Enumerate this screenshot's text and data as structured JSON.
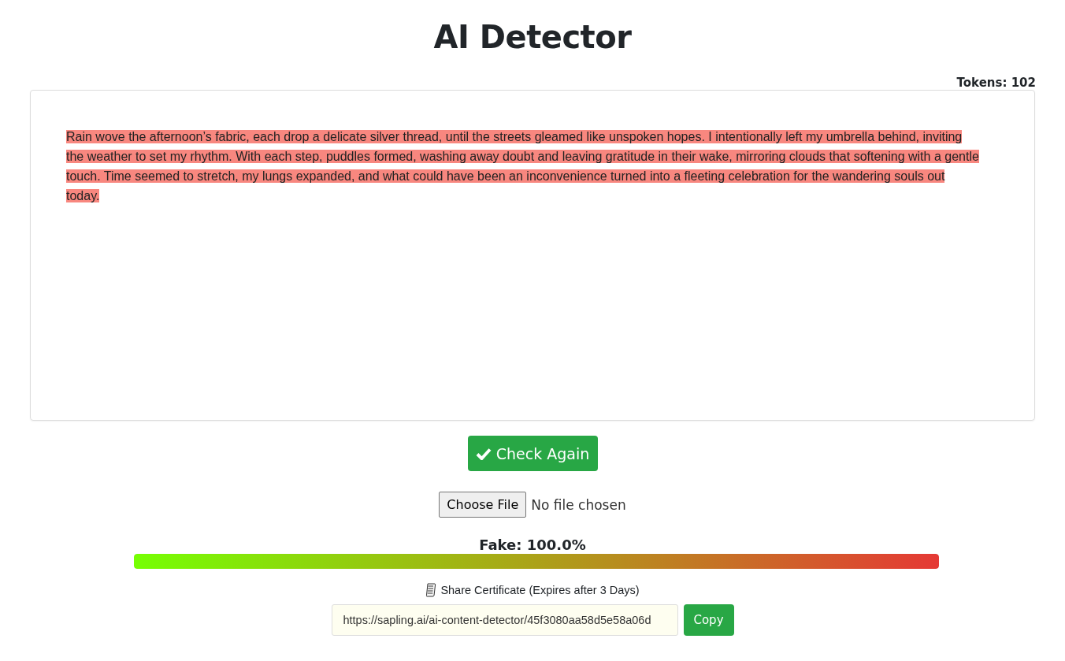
{
  "title": "AI Detector",
  "tokens": "Tokens: 102",
  "passage": {
    "text": "Rain wove the afternoon’s fabric, each drop a delicate silver thread, until the streets gleamed like unspoken hopes. I intentionally left my umbrella behind, inviting the weather to set my rhythm. With each step, puddles formed, washing away doubt and leaving gratitude in their wake, mirroring clouds that softening with a gentle touch. Time seemed to stretch, my lungs expanded, and what could have been an inconvenience turned into a fleeting celebration for the wandering souls out today.",
    "highlighted": true
  },
  "check_button": "Check Again",
  "file_input": {
    "button": "Choose File",
    "status": "No file chosen"
  },
  "score": {
    "label": "Fake: 100.0%",
    "level": 1.0
  },
  "share": {
    "label": "Share Certificate (Expires after 3 Days)",
    "url": "https://sapling.ai/ai-content-detector/45f3080aa58d5e58a06d",
    "copy_button": "Copy"
  }
}
